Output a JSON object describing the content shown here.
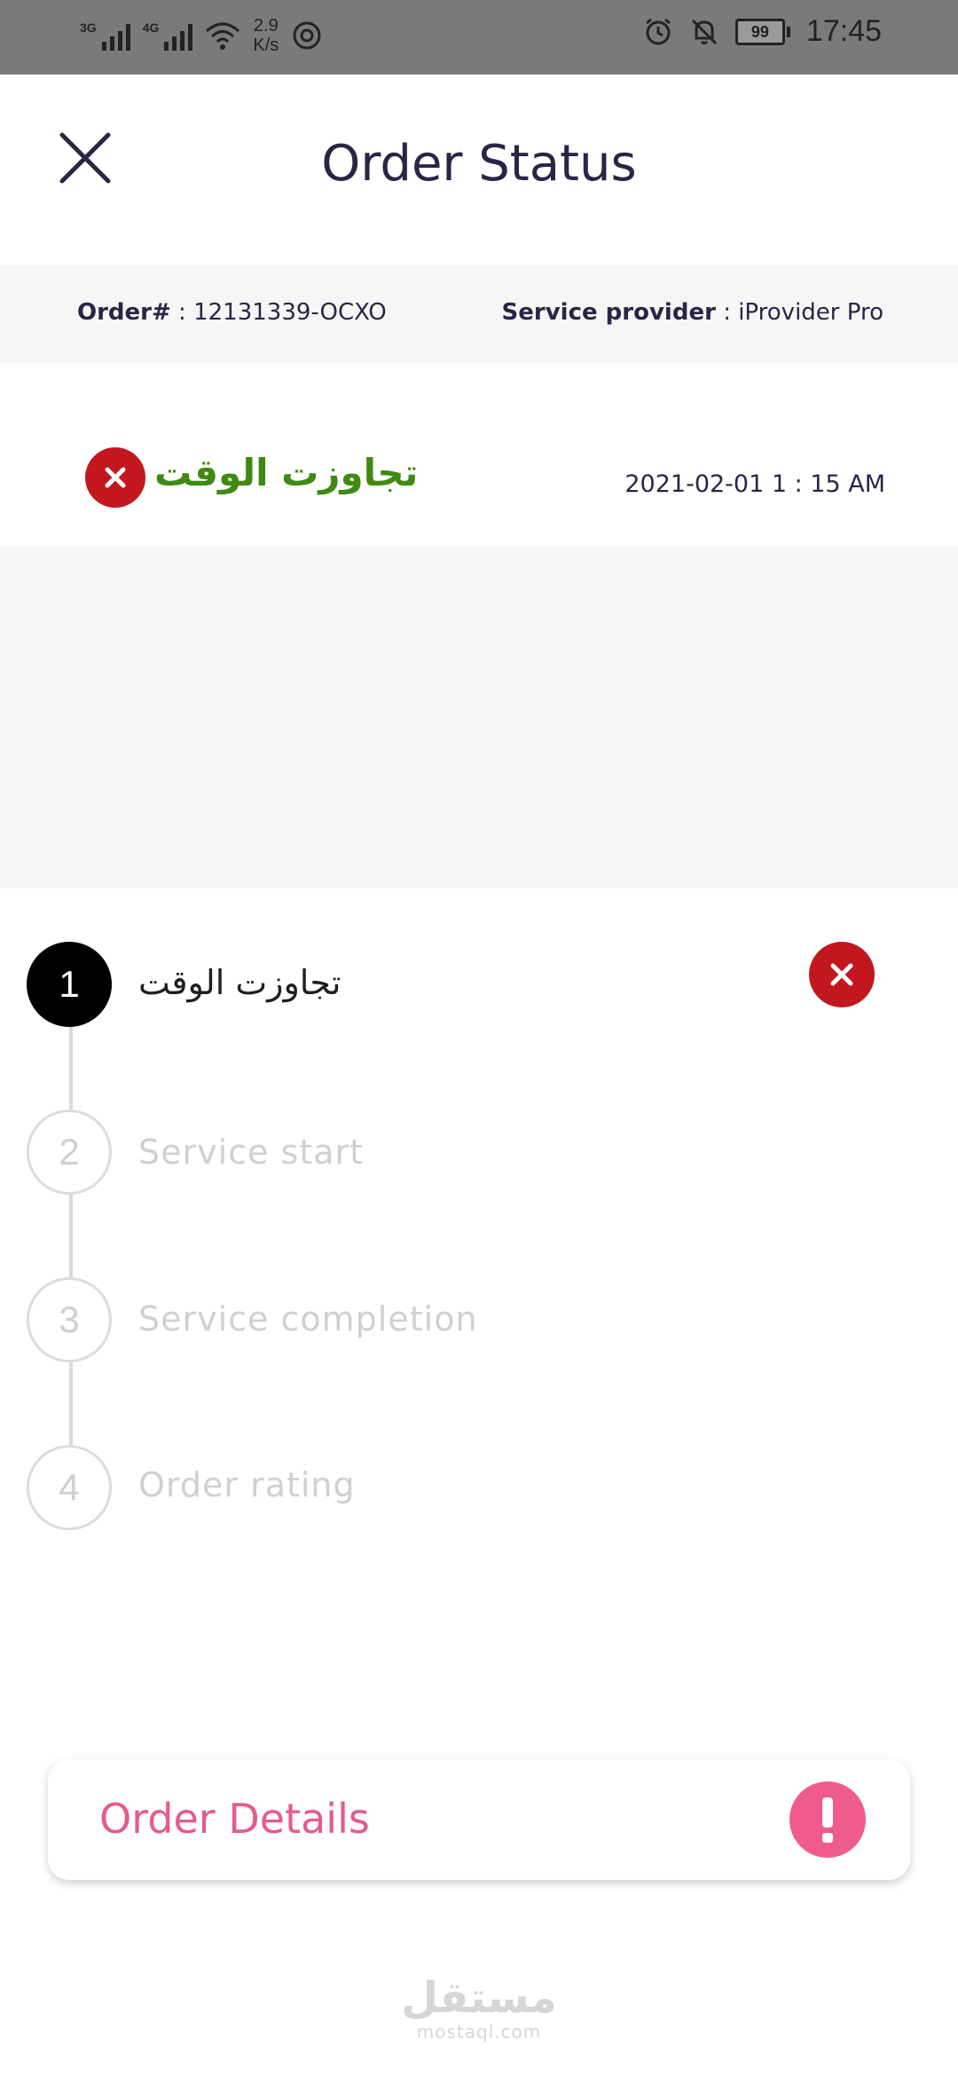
{
  "status_bar": {
    "network1": "3G",
    "network2": "4G",
    "speed_value": "2.9",
    "speed_unit": "K/s",
    "battery": "99",
    "time": "17:45"
  },
  "header": {
    "title": "Order Status"
  },
  "order_info": {
    "order_label": "Order#",
    "order_value": ": 12131339-OCXO",
    "provider_label": "Service provider",
    "provider_value": ": iProvider Pro"
  },
  "current_status": {
    "text": "تجاوزت الوقت",
    "datetime": "2021-02-01   1 : 15 AM"
  },
  "steps": [
    {
      "number": "1",
      "label": "تجاوزت الوقت"
    },
    {
      "number": "2",
      "label": "Service start"
    },
    {
      "number": "3",
      "label": "Service completion"
    },
    {
      "number": "4",
      "label": "Order rating"
    }
  ],
  "details": {
    "label": "Order Details"
  },
  "watermark": {
    "arabic": "مستقل",
    "latin": "mostaql.com"
  },
  "colors": {
    "fail": "#c2171f",
    "status_text": "#3f8a12",
    "accent": "#e65a8f",
    "title": "#2b2545"
  },
  "icons": [
    "signal-icon",
    "wifi-icon",
    "alarm-icon",
    "bell-off-icon",
    "battery-icon",
    "close-icon",
    "x-circle-icon",
    "exclamation-icon"
  ]
}
